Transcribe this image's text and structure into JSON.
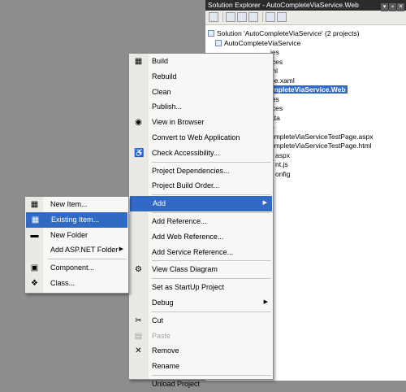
{
  "solution_explorer": {
    "title": "Solution Explorer - AutoCompleteViaService.Web",
    "title_buttons": [
      "▾",
      "▪",
      "✕"
    ],
    "tree": [
      {
        "text": "Solution 'AutoCompleteViaService' (2 projects)",
        "indent": 3,
        "selected": false
      },
      {
        "text": "AutoCompleteViaService",
        "indent": 12,
        "selected": false
      },
      {
        "text": "ies",
        "indent": 80,
        "selected": false
      },
      {
        "text": "ices",
        "indent": 80,
        "selected": false
      },
      {
        "text": "ml",
        "indent": 80,
        "selected": false
      },
      {
        "text": "ge.xaml",
        "indent": 80,
        "selected": false
      },
      {
        "text": "ompleteViaService.Web",
        "indent": 75,
        "selected": true
      },
      {
        "text": "ies",
        "indent": 80,
        "selected": false
      },
      {
        "text": "ices",
        "indent": 80,
        "selected": false
      },
      {
        "text": "ata",
        "indent": 80,
        "selected": false
      },
      {
        "text": "n",
        "indent": 80,
        "selected": false
      },
      {
        "text": "ompleteViaServiceTestPage.aspx",
        "indent": 80,
        "selected": false
      },
      {
        "text": "ompleteViaServiceTestPage.html",
        "indent": 80,
        "selected": false
      },
      {
        "text": "aspx",
        "indent": 86,
        "selected": false
      },
      {
        "text": "nt.js",
        "indent": 86,
        "selected": false
      },
      {
        "text": "onfig",
        "indent": 86,
        "selected": false
      }
    ]
  },
  "context_menu": {
    "items": [
      {
        "type": "item",
        "label": "Build",
        "icon": "build-icon",
        "glyph": "▦"
      },
      {
        "type": "item",
        "label": "Rebuild"
      },
      {
        "type": "item",
        "label": "Clean"
      },
      {
        "type": "item",
        "label": "Publish..."
      },
      {
        "type": "item",
        "label": "View in Browser",
        "icon": "browser-icon",
        "glyph": "◉"
      },
      {
        "type": "item",
        "label": "Convert to Web Application"
      },
      {
        "type": "item",
        "label": "Check Accessibility...",
        "icon": "accessibility-icon",
        "glyph": "♿"
      },
      {
        "type": "sep"
      },
      {
        "type": "item",
        "label": "Project Dependencies..."
      },
      {
        "type": "item",
        "label": "Project Build Order..."
      },
      {
        "type": "sep"
      },
      {
        "type": "item",
        "label": "Add",
        "highlight": true,
        "submenu": true
      },
      {
        "type": "sep"
      },
      {
        "type": "item",
        "label": "Add Reference..."
      },
      {
        "type": "item",
        "label": "Add Web Reference..."
      },
      {
        "type": "item",
        "label": "Add Service Reference..."
      },
      {
        "type": "sep"
      },
      {
        "type": "item",
        "label": "View Class Diagram",
        "icon": "class-diagram-icon",
        "glyph": "⚙"
      },
      {
        "type": "sep"
      },
      {
        "type": "item",
        "label": "Set as StartUp Project"
      },
      {
        "type": "item",
        "label": "Debug",
        "submenu": true
      },
      {
        "type": "sep"
      },
      {
        "type": "item",
        "label": "Cut",
        "icon": "cut-icon",
        "glyph": "✂"
      },
      {
        "type": "item",
        "label": "Paste",
        "icon": "paste-icon",
        "glyph": "▤",
        "disabled": true
      },
      {
        "type": "item",
        "label": "Remove",
        "icon": "remove-icon",
        "glyph": "✕"
      },
      {
        "type": "item",
        "label": "Rename"
      },
      {
        "type": "sep"
      },
      {
        "type": "item",
        "label": "Unload Project"
      }
    ]
  },
  "add_submenu": {
    "items": [
      {
        "type": "item",
        "label": "New Item...",
        "icon": "new-item-icon",
        "glyph": "▦"
      },
      {
        "type": "item",
        "label": "Existing Item...",
        "icon": "existing-item-icon",
        "glyph": "▦",
        "highlight": true
      },
      {
        "type": "item",
        "label": "New Folder",
        "icon": "folder-icon",
        "glyph": "▬"
      },
      {
        "type": "item",
        "label": "Add ASP.NET Folder",
        "submenu": true
      },
      {
        "type": "sep"
      },
      {
        "type": "item",
        "label": "Component...",
        "icon": "component-icon",
        "glyph": "▣"
      },
      {
        "type": "item",
        "label": "Class...",
        "icon": "class-icon",
        "glyph": "❖"
      }
    ]
  }
}
